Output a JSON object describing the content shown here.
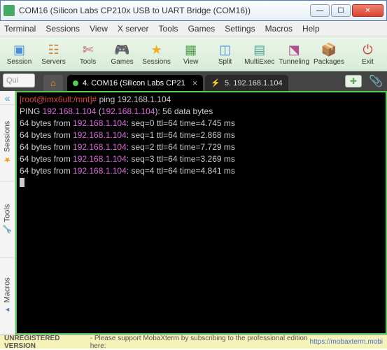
{
  "window": {
    "title": "COM16  (Silicon Labs CP210x USB to UART Bridge (COM16))"
  },
  "menu": {
    "terminal": "Terminal",
    "sessions": "Sessions",
    "view": "View",
    "xserver": "X server",
    "tools": "Tools",
    "games": "Games",
    "settings": "Settings",
    "macros": "Macros",
    "help": "Help"
  },
  "toolbar": {
    "session": "Session",
    "servers": "Servers",
    "tools": "Tools",
    "games": "Games",
    "sessions": "Sessions",
    "view": "View",
    "split": "Split",
    "multiexec": "MultiExec",
    "tunneling": "Tunneling",
    "packages": "Packages",
    "exit": "Exit"
  },
  "quickconnect": {
    "placeholder": "Qui"
  },
  "tabs": [
    {
      "label": "4. COM16  (Silicon Labs CP21",
      "active": true
    },
    {
      "label": "5. 192.168.1.104",
      "active": false
    }
  ],
  "sidetabs": {
    "sessions": "Sessions",
    "tools": "Tools",
    "macros": "Macros"
  },
  "terminal": {
    "prompt_user": "[root@imx6ull:/mnt]# ",
    "command": "ping 192.168.1.104",
    "header_a": "PING ",
    "header_ip": "192.168.1.104",
    "header_b": " (",
    "header_c": "): 56 data bytes",
    "lines": [
      {
        "pre": "64 bytes from ",
        "ip": "192.168.1.104",
        "post": ": seq=0 ttl=64 time=4.745 ms"
      },
      {
        "pre": "64 bytes from ",
        "ip": "192.168.1.104",
        "post": ": seq=1 ttl=64 time=2.868 ms"
      },
      {
        "pre": "64 bytes from ",
        "ip": "192.168.1.104",
        "post": ": seq=2 ttl=64 time=7.729 ms"
      },
      {
        "pre": "64 bytes from ",
        "ip": "192.168.1.104",
        "post": ": seq=3 ttl=64 time=3.269 ms"
      },
      {
        "pre": "64 bytes from ",
        "ip": "192.168.1.104",
        "post": ": seq=4 ttl=64 time=4.841 ms"
      }
    ]
  },
  "status": {
    "label": "UNREGISTERED VERSION",
    "text": " -  Please support MobaXterm by subscribing to the professional edition here: ",
    "link": "https://mobaxterm.mobi"
  }
}
